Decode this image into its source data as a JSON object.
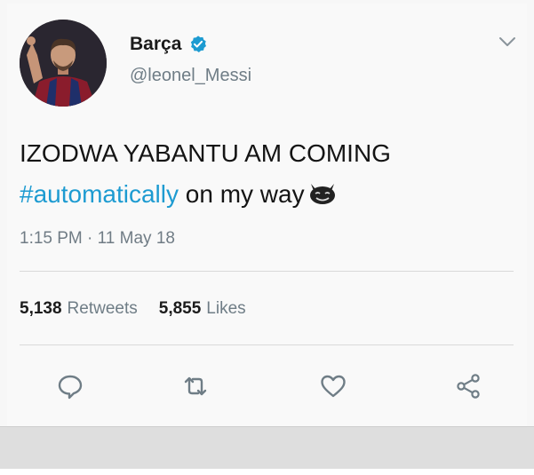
{
  "author": {
    "name": "Barça",
    "handle": "@leonel_Messi",
    "verified": true
  },
  "tweet": {
    "line1": "IZODWA YABANTU AM COMING",
    "hashtag": "#automatically",
    "line2_rest": " on my way",
    "emoji": "devil-face-icon",
    "timestamp": "1:15 PM · 11 May 18"
  },
  "stats": {
    "retweets_count": "5,138",
    "retweets_label": "Retweets",
    "likes_count": "5,855",
    "likes_label": "Likes"
  },
  "actions": [
    "reply-icon",
    "retweet-icon",
    "like-icon",
    "share-icon"
  ],
  "colors": {
    "accent": "#1d9bd1",
    "secondary_text": "#6f7d86",
    "icon": "#6f7d86"
  }
}
